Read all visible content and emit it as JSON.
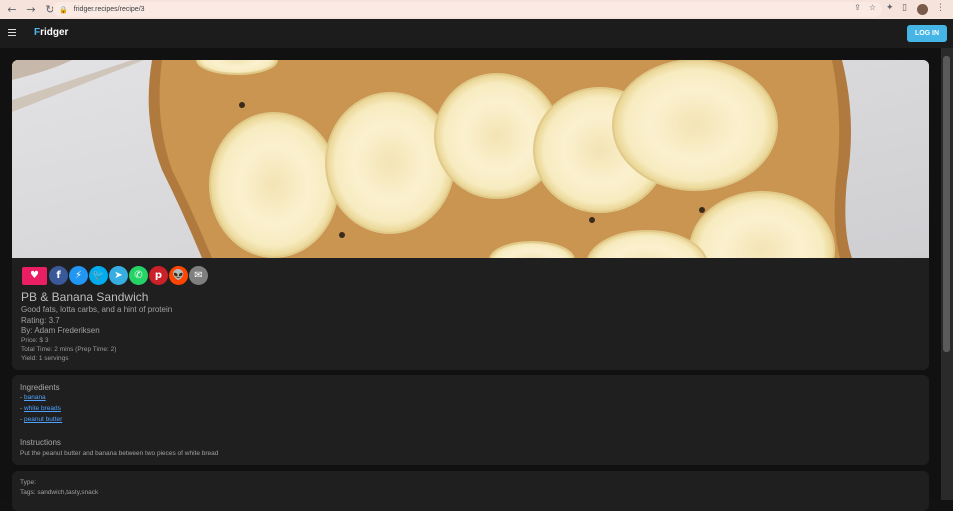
{
  "browser": {
    "url": "fridger.recipes/recipe/3",
    "nav": {
      "back": "←",
      "forward": "→",
      "reload": "↻"
    }
  },
  "appbar": {
    "brand_first": "F",
    "brand_rest": "ridger",
    "login_label": "LOG IN"
  },
  "recipe": {
    "title": "PB & Banana Sandwich",
    "description": "Good fats, lotta carbs, and a hint of protein",
    "rating": "Rating: 3.7",
    "author": "By: Adam Frederiksen",
    "price": "Price: $ 3",
    "time": "Total Time: 2 mins (Prep Time: 2)",
    "yield": "Yield: 1 servings"
  },
  "share": [
    {
      "name": "facebook-icon",
      "glyph": "f",
      "color": "#3b5998"
    },
    {
      "name": "messenger-icon",
      "glyph": "⚡",
      "color": "#2196f3"
    },
    {
      "name": "twitter-icon",
      "glyph": "🐦",
      "color": "#00aced"
    },
    {
      "name": "telegram-icon",
      "glyph": "➤",
      "color": "#37aee2"
    },
    {
      "name": "whatsapp-icon",
      "glyph": "✆",
      "color": "#25d366"
    },
    {
      "name": "pinterest-icon",
      "glyph": "p",
      "color": "#cb2128"
    },
    {
      "name": "reddit-icon",
      "glyph": "👽",
      "color": "#ff4500"
    },
    {
      "name": "email-icon",
      "glyph": "✉",
      "color": "#7f7f7f"
    }
  ],
  "ingredients": {
    "heading": "Ingredients",
    "prefix": "- ",
    "items": [
      "banana",
      "white breads",
      "peanut butter"
    ]
  },
  "instructions": {
    "heading": "Instructions",
    "text": "Put the peanut butter and banana between two pieces of white bread"
  },
  "meta": {
    "type": "Type:",
    "tags": "Tags: sandwich,tasty,snack"
  }
}
